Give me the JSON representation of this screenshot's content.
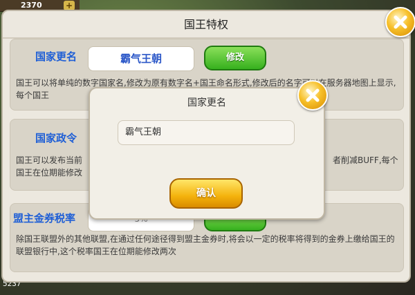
{
  "hud": {
    "top_counter": "2370",
    "top_plus": "+",
    "bottom_number": "5237"
  },
  "panel": {
    "title": "国王特权",
    "rename": {
      "label": "国家更名",
      "current_name": "霸气王朝",
      "modify_button": "修改",
      "description": "国王可以将单纯的数字国家名,修改为原有数字名+国王命名形式,修改后的名字可以在服务器地图上显示,每个国王"
    },
    "decree": {
      "label": "国家政令",
      "description_line1": "国王可以发布当前",
      "description_line1_end": "者削减BUFF,每个",
      "description_line2": "国王在位期能修改"
    },
    "tax": {
      "label": "盟主金券税率",
      "rate_value": "5%",
      "description": "除国王联盟外的其他联盟,在通过任何途径得到盟主金券时,将会以一定的税率将得到的金券上缴给国王的联盟银行中,这个税率国王在位期能修改两次"
    }
  },
  "dialog": {
    "title": "国家更名",
    "input_value": "霸气王朝",
    "confirm_button": "确认"
  },
  "icons": {
    "close": "close-icon"
  }
}
